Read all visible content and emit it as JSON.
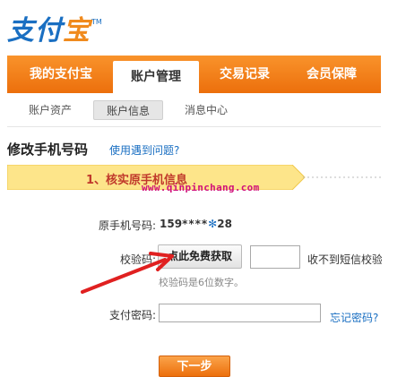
{
  "logo": {
    "text_a": "支付",
    "text_b": "宝",
    "tm": "TM"
  },
  "mainnav": {
    "tabs": [
      {
        "label": "我的支付宝"
      },
      {
        "label": "账户管理"
      },
      {
        "label": "交易记录"
      },
      {
        "label": "会员保障"
      }
    ]
  },
  "subnav": {
    "items": [
      {
        "label": "账户资产"
      },
      {
        "label": "账户信息"
      },
      {
        "label": "消息中心"
      }
    ]
  },
  "page": {
    "title": "修改手机号码",
    "help_link": "使用遇到问题?"
  },
  "step": {
    "label": "1、核实原手机信息"
  },
  "watermark": "www.qinpinchang.com",
  "form": {
    "phone_label": "原手机号码:",
    "phone_prefix": "159",
    "phone_mask": "****",
    "phone_suffix": "28",
    "code_label": "校验码:",
    "code_button": "点此免费获取",
    "no_sms": "收不到短信校验",
    "code_hint": "校验码是6位数字。",
    "pay_label": "支付密码:",
    "forgot_link": "忘记密码?",
    "next_button": "下一步"
  },
  "colors": {
    "brand_orange": "#ec6f0c",
    "brand_blue": "#1a6fc2",
    "arrow_red": "#e02020",
    "watermark": "#d0107a"
  }
}
